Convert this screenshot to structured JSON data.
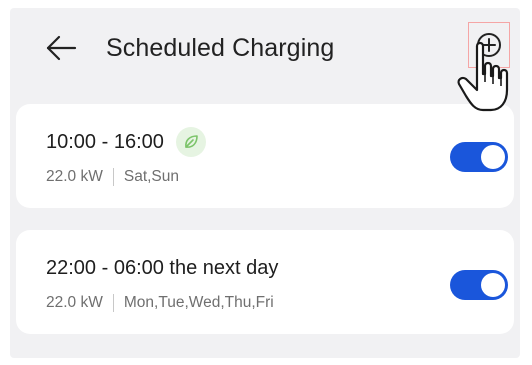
{
  "header": {
    "title": "Scheduled Charging",
    "back_icon": "arrow-left-icon",
    "add_icon": "plus-circle-icon"
  },
  "schedules": [
    {
      "time": "10:00 - 16:00",
      "eco_icon": "leaf-icon",
      "power": "22.0 kW",
      "days": "Sat,Sun",
      "enabled": true
    },
    {
      "time": "22:00 - 06:00 the next day",
      "power": "22.0 kW",
      "days": "Mon,Tue,Wed,Thu,Fri",
      "enabled": true
    }
  ],
  "colors": {
    "background": "#f1f1f3",
    "card": "#ffffff",
    "toggle_on": "#1a56db",
    "eco_green": "#7cc46a",
    "highlight_border": "#f5a5a5"
  }
}
